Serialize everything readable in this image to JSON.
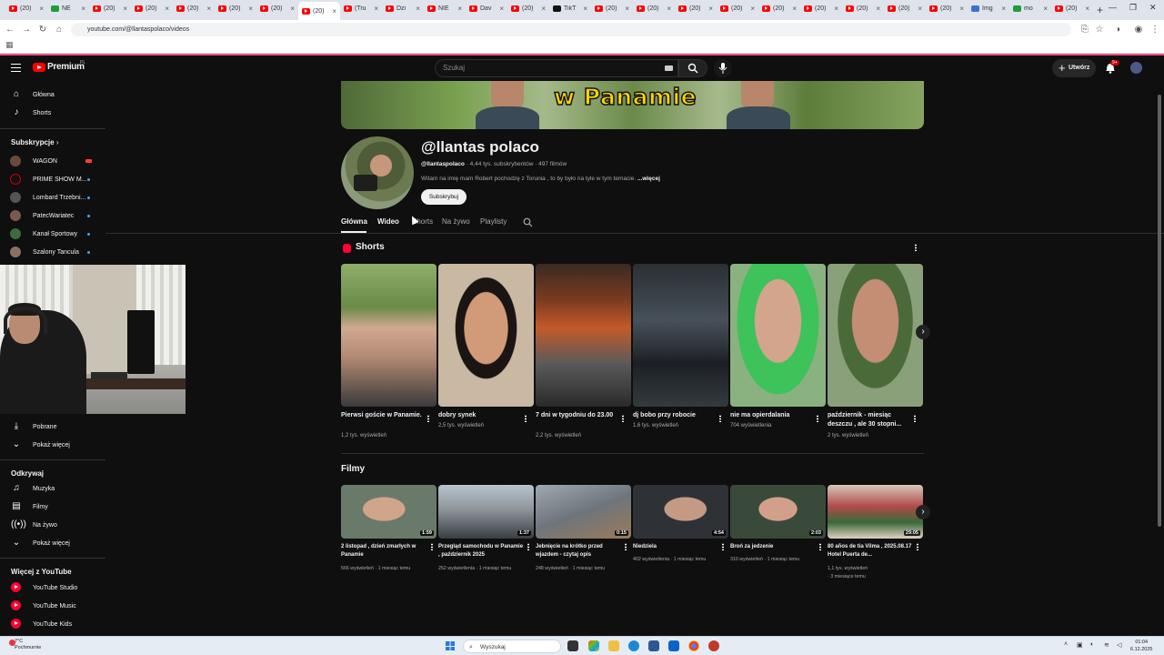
{
  "browser": {
    "tabs": [
      {
        "label": "(20)",
        "icon": "youtube-icon"
      },
      {
        "label": "NE",
        "icon": "green-icon"
      },
      {
        "label": "(20)",
        "icon": "youtube-icon"
      },
      {
        "label": "(20)",
        "icon": "youtube-icon"
      },
      {
        "label": "(20)",
        "icon": "youtube-icon"
      },
      {
        "label": "(20)",
        "icon": "youtube-icon"
      },
      {
        "label": "(20)",
        "icon": "youtube-icon"
      },
      {
        "label": "(20)",
        "icon": "youtube-icon"
      },
      {
        "label": "(Tru",
        "icon": "youtube-icon"
      },
      {
        "label": "Dzi",
        "icon": "youtube-icon"
      },
      {
        "label": "NIE",
        "icon": "youtube-icon"
      },
      {
        "label": "Dav",
        "icon": "youtube-icon"
      },
      {
        "label": "(20)",
        "icon": "youtube-icon"
      },
      {
        "label": "TikT",
        "icon": "tiktok-icon"
      },
      {
        "label": "(20)",
        "icon": "youtube-icon"
      },
      {
        "label": "(20)",
        "icon": "youtube-icon"
      },
      {
        "label": "(20)",
        "icon": "youtube-icon"
      },
      {
        "label": "(20)",
        "icon": "youtube-icon"
      },
      {
        "label": "(20)",
        "icon": "youtube-icon"
      },
      {
        "label": "(20)",
        "icon": "youtube-icon"
      },
      {
        "label": "(20)",
        "icon": "youtube-icon"
      },
      {
        "label": "(20)",
        "icon": "youtube-icon"
      },
      {
        "label": "(20)",
        "icon": "youtube-icon"
      },
      {
        "label": "Img",
        "icon": "image-icon"
      },
      {
        "label": "mo",
        "icon": "green-icon"
      },
      {
        "label": "(20)",
        "icon": "youtube-icon"
      }
    ],
    "url": "youtube.com/@llantaspolaco/videos"
  },
  "header": {
    "logo": "Premium",
    "logo_sup": "PL",
    "search_placeholder": "Szukaj",
    "create_label": "Utwórz",
    "notif_badge": "9+"
  },
  "sidebar": {
    "home": "Główna",
    "shorts": "Shorts",
    "subs_header": "Subskrypcje",
    "subs": [
      "WAGON",
      "PRIME SHOW M...",
      "Lombard Trzebni...",
      "PatecWariatec",
      "Kanał Sportowy",
      "Szalony Tancula"
    ],
    "downloads": "Pobrane",
    "show_more": "Pokaż więcej",
    "explore_header": "Odkrywaj",
    "explore": [
      "Muzyka",
      "Filmy",
      "Na żywo"
    ],
    "show_more2": "Pokaż więcej",
    "more_header": "Więcej z YouTube",
    "more": [
      "YouTube Studio",
      "YouTube Music",
      "YouTube Kids"
    ]
  },
  "channel": {
    "banner_text": "w Panamie",
    "name": "@llantas polaco",
    "handle": "@llantaspolaco",
    "stats": " · 4,44 tys. subskrybentów · 497 filmów",
    "desc": "Witam na imię mam Robert pochodzę z Torunia , to by było na tyle w tym temacie. ",
    "desc_more": "...więcej",
    "subscribe": "Subskrybuj",
    "tabs": [
      "Główna",
      "Wideo",
      "Shorts",
      "Na żywo",
      "Playlisty"
    ]
  },
  "shorts": {
    "heading": "Shorts",
    "items": [
      {
        "title": "Pierwsi goście w Panamie.",
        "views": "1,2 tys. wyświetleń"
      },
      {
        "title": "dobry synek",
        "views": "2,5 tys. wyświetleń"
      },
      {
        "title": "7 dni w tygodniu do 23.00",
        "views": "2,2 tys. wyświetleń"
      },
      {
        "title": "dj bobo przy robocie",
        "views": "1,6 tys. wyświetleń"
      },
      {
        "title": "nie ma opierdalania",
        "views": "704 wyświetlenia"
      },
      {
        "title": "październik - miesiąc deszczu , ale 30 stopni...",
        "views": "2 tys. wyświetleń"
      }
    ]
  },
  "videos": {
    "heading": "Filmy",
    "items": [
      {
        "title": "2 listopad , dzień zmarłych w Panamie",
        "duration": "1:59",
        "meta": "566 wyświetleń · 1 miesiąc temu"
      },
      {
        "title": "Przegląd samochodu w Panamie , październik 2025",
        "duration": "1:37",
        "meta": "252 wyświetlenia · 1 miesiąc temu"
      },
      {
        "title": "Jebnięcie na krótko przed wjazdem - czytaj opis",
        "duration": "0:15",
        "meta": "248 wyświetleń · 1 miesiąc temu"
      },
      {
        "title": "Niedziela",
        "duration": "4:54",
        "meta": "402 wyświetlenia · 1 miesiąc temu"
      },
      {
        "title": "Broń za jedzenie",
        "duration": "2:03",
        "meta": "310 wyświetleń · 1 miesiąc temu"
      },
      {
        "title": "80 años de tia Vilma , 2025.08.17 Hotel Puerta de...",
        "duration": "29:05",
        "meta1": "1,1 tys. wyświetleń",
        "meta2": "· 3 miesiące temu"
      }
    ]
  },
  "taskbar": {
    "temp": "7°C",
    "weather": "Pochmurnie",
    "search": "Wyszukaj",
    "time": "01:04",
    "date": "6.12.2025"
  }
}
